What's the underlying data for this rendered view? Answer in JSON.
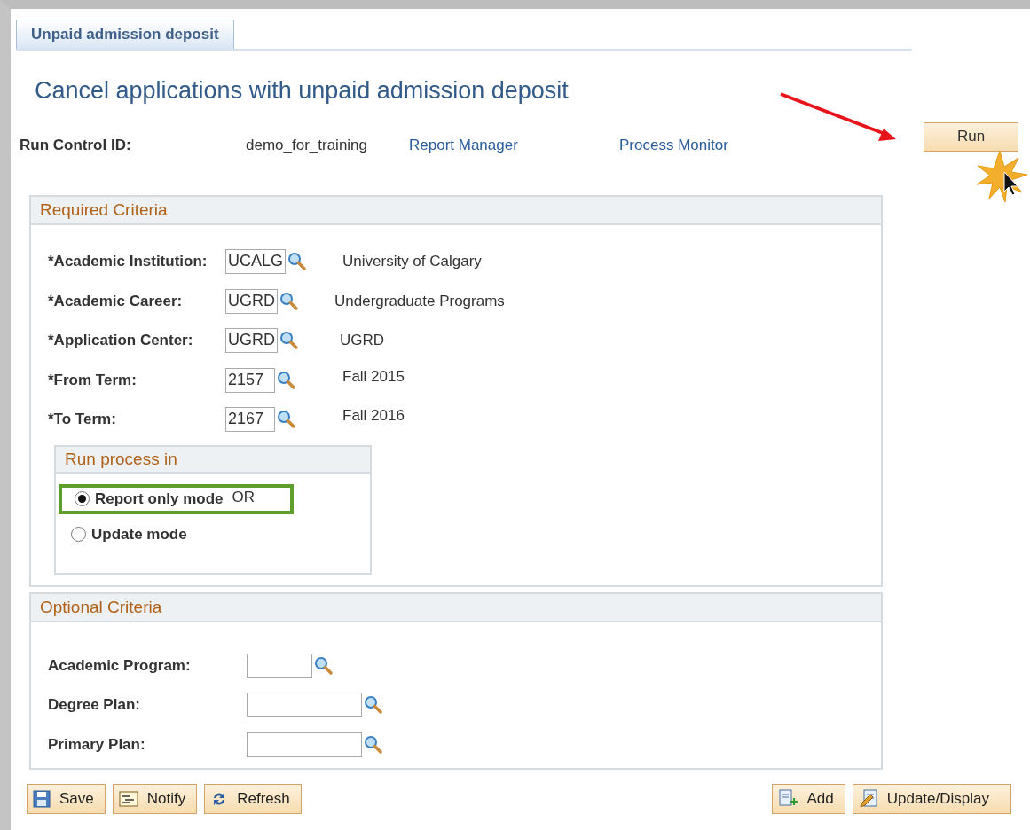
{
  "tab": {
    "label": "Unpaid admission deposit",
    "selected": true
  },
  "title": "Cancel applications with unpaid admission deposit",
  "run_control": {
    "label": "Run Control ID:",
    "value": "demo_for_training",
    "links": [
      "Report Manager",
      "Process Monitor"
    ]
  },
  "run_button": {
    "label": "Run"
  },
  "required_criteria": {
    "title": "Required Criteria",
    "fields": [
      {
        "label": "*Academic Institution:",
        "value": "UCALG",
        "description": "University of Calgary"
      },
      {
        "label": "*Academic Career:",
        "value": "UGRD",
        "description": "Undergraduate Programs"
      },
      {
        "label": "*Application Center:",
        "value": "UGRD",
        "description": "UGRD"
      },
      {
        "label": "*From Term:",
        "value": "2157",
        "description": "Fall 2015"
      },
      {
        "label": "*To Term:",
        "value": "2167",
        "description": "Fall 2016"
      }
    ],
    "run_process": {
      "title": "Run process in",
      "options": [
        {
          "label": "Report only mode",
          "selected": true,
          "highlighted": true,
          "note": "OR"
        },
        {
          "label": "Update mode",
          "selected": false,
          "highlighted": false
        }
      ]
    }
  },
  "optional_criteria": {
    "title": "Optional Criteria",
    "fields": [
      {
        "label": "Academic Program:",
        "kind": "short"
      },
      {
        "label": "Degree Plan:",
        "kind": "long"
      },
      {
        "label": "Primary Plan:",
        "kind": "long"
      }
    ]
  },
  "toolbar_left": [
    {
      "label": "Save",
      "kind": "save"
    },
    {
      "label": "Notify",
      "kind": "notify"
    },
    {
      "label": "Refresh",
      "kind": "refresh"
    }
  ],
  "toolbar_right": [
    {
      "label": "Add",
      "kind": "add"
    },
    {
      "label": "Update/Display",
      "kind": "update"
    }
  ]
}
